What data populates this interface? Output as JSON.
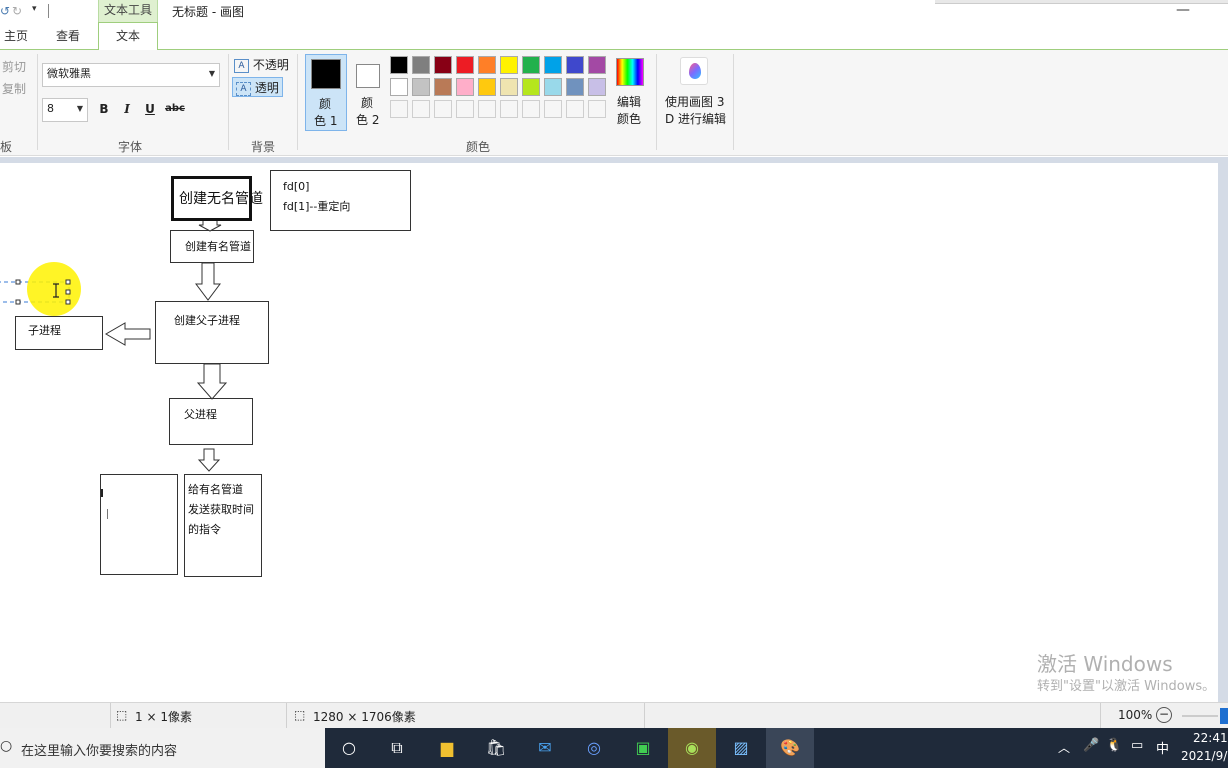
{
  "title_bar": {
    "context_tab": "文本工具",
    "window_title": "无标题 - 画图",
    "minimize": "—"
  },
  "tabs": [
    "主页",
    "查看",
    "文本"
  ],
  "ribbon": {
    "clipboard": {
      "cut": "剪切",
      "copy": "复制",
      "label": "板"
    },
    "font": {
      "family": "微软雅黑",
      "size": "8",
      "bold": "B",
      "italic": "I",
      "underline": "U",
      "strike": "abc",
      "label": "字体"
    },
    "background": {
      "opaque": "不透明",
      "transparent": "透明",
      "label": "背景"
    },
    "colors": {
      "color1_label_a": "颜",
      "color1_label_b": "色 1",
      "color2_label_a": "颜",
      "color2_label_b": "色 2",
      "edit_a": "编辑",
      "edit_b": "颜色",
      "label": "颜色",
      "color1": "#000000",
      "color2": "#ffffff",
      "palette_row1": [
        "#000000",
        "#7f7f7f",
        "#880015",
        "#ed1c24",
        "#ff7f27",
        "#fff200",
        "#22b14c",
        "#00a2e8",
        "#3f48cc",
        "#a349a4"
      ],
      "palette_row2": [
        "#ffffff",
        "#c3c3c3",
        "#b97a57",
        "#ffaec9",
        "#ffc90e",
        "#efe4b0",
        "#b5e61d",
        "#99d9ea",
        "#7092be",
        "#c8bfe7"
      ]
    },
    "paint3d": {
      "line1": "使用画图 3",
      "line2": "D 进行编辑"
    }
  },
  "diagram": {
    "pipe_unnamed": "创建无名管道",
    "fd_line1": "fd[0]",
    "fd_line2": "fd[1]--重定向",
    "pipe_named": "创建有名管道",
    "fork": "创建父子进程",
    "child": "子进程",
    "parent": "父进程",
    "send_line1": "给有名管道",
    "send_line2": "发送获取时间",
    "send_line3": "的指令"
  },
  "watermark": {
    "line1": "激活 Windows",
    "line2": "转到\"设置\"以激活 Windows。"
  },
  "status": {
    "selection": "1 × 1像素",
    "canvas_size": "1280 × 1706像素",
    "zoom": "100%"
  },
  "taskbar": {
    "search_placeholder": "在这里输入你要搜索的内容",
    "time": "22:41",
    "date": "2021/9/",
    "ime": "中"
  }
}
